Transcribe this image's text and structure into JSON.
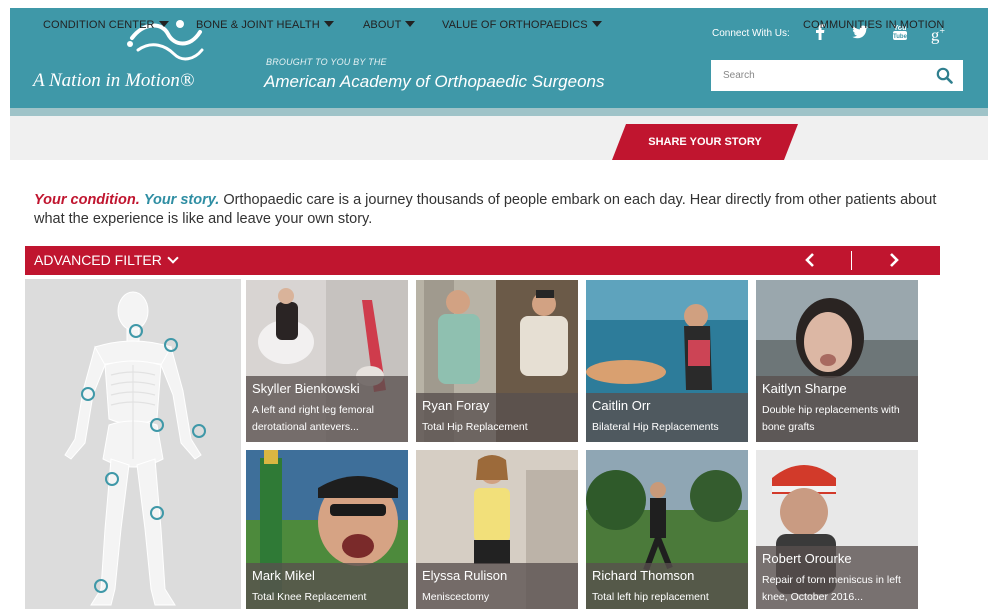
{
  "header": {
    "logo_text": "A Nation in Motion®",
    "brought_by": "BROUGHT TO YOU BY THE",
    "org_name": "American Academy of Orthopaedic Surgeons",
    "connect_label": "Connect With Us:",
    "social": [
      {
        "icon": "facebook-icon",
        "glyph": "f"
      },
      {
        "icon": "twitter-icon",
        "glyph": "t"
      },
      {
        "icon": "youtube-icon",
        "glyph": "You Tube"
      },
      {
        "icon": "google-plus-icon",
        "glyph": "g+"
      }
    ],
    "search": {
      "placeholder": "Search",
      "value": ""
    },
    "accent_color": "#3f98a8"
  },
  "nav": {
    "items": [
      {
        "label": "CONDITION CENTER",
        "has_dropdown": true
      },
      {
        "label": "BONE & JOINT HEALTH",
        "has_dropdown": true
      },
      {
        "label": "ABOUT",
        "has_dropdown": true
      },
      {
        "label": "VALUE OF ORTHOPAEDICS",
        "has_dropdown": true
      },
      {
        "label": "SHARE YOUR STORY",
        "has_dropdown": false,
        "active": true
      },
      {
        "label": "COMMUNITIES IN MOTION",
        "has_dropdown": false
      }
    ],
    "active_color": "#c0152f"
  },
  "intro": {
    "highlight1": "Your condition.",
    "highlight2": "Your story.",
    "text": "Orthopaedic care is a journey thousands of people embark on each day. Hear directly from other patients about what the experience is like and leave your own story."
  },
  "filter": {
    "label": "ADVANCED FILTER",
    "prev_icon": "chevron-left-icon",
    "next_icon": "chevron-right-icon"
  },
  "stories": [
    {
      "name": "Skyller Bienkowski",
      "desc": "A left and right leg femoral derotational antevers..."
    },
    {
      "name": "Ryan Foray",
      "desc": "Total Hip Replacement"
    },
    {
      "name": "Caitlin Orr",
      "desc": "Bilateral Hip Replacements"
    },
    {
      "name": "Kaitlyn Sharpe",
      "desc": "Double hip replacements with bone grafts"
    },
    {
      "name": "Mark Mikel",
      "desc": "Total Knee Replacement"
    },
    {
      "name": "Elyssa Rulison",
      "desc": "Meniscectomy"
    },
    {
      "name": "Richard Thomson",
      "desc": "Total left hip replacement"
    },
    {
      "name": "Robert Orourke",
      "desc": "Repair of torn meniscus in left knee, October 2016..."
    }
  ]
}
